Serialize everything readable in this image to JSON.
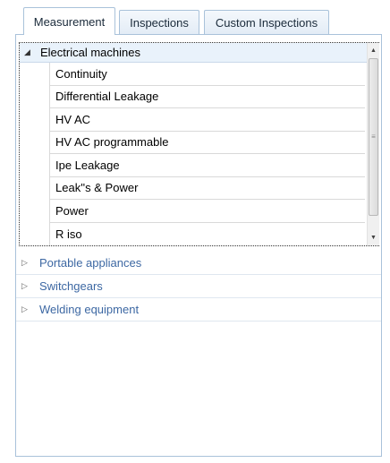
{
  "tabs": [
    {
      "label": "Measurement",
      "active": true
    },
    {
      "label": "Inspections",
      "active": false
    },
    {
      "label": "Custom Inspections",
      "active": false
    }
  ],
  "groups": [
    {
      "label": "Electrical machines",
      "expanded": true,
      "arrow_icon": "triangle-down-icon",
      "items": [
        {
          "label": "Continuity"
        },
        {
          "label": "Differential Leakage"
        },
        {
          "label": "HV AC"
        },
        {
          "label": "HV AC programmable"
        },
        {
          "label": "Ipe Leakage"
        },
        {
          "label": "Leak''s & Power"
        },
        {
          "label": "Power"
        },
        {
          "label": "R iso"
        }
      ]
    },
    {
      "label": "Portable appliances",
      "expanded": false,
      "arrow_icon": "triangle-right-icon"
    },
    {
      "label": "Switchgears",
      "expanded": false,
      "arrow_icon": "triangle-right-icon"
    },
    {
      "label": "Welding equipment",
      "expanded": false,
      "arrow_icon": "triangle-right-icon"
    }
  ],
  "colors": {
    "border": "#a9c2da",
    "header_bg": "#e9f2fb",
    "collapsed_text": "#3d68a3"
  },
  "scrollbar": {
    "position": 0
  }
}
